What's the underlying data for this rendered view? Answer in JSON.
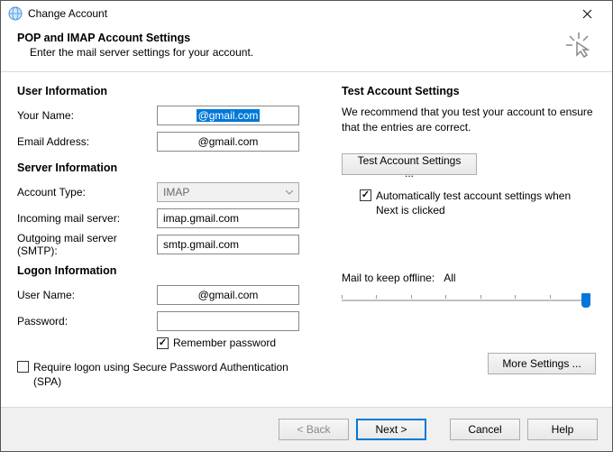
{
  "window": {
    "title": "Change Account"
  },
  "header": {
    "title": "POP and IMAP Account Settings",
    "subtitle": "Enter the mail server settings for your account."
  },
  "sections": {
    "user_info": "User Information",
    "server_info": "Server Information",
    "logon_info": "Logon Information",
    "test_settings": "Test Account Settings"
  },
  "labels": {
    "your_name": "Your Name:",
    "email_address": "Email Address:",
    "account_type": "Account Type:",
    "incoming": "Incoming mail server:",
    "outgoing": "Outgoing mail server (SMTP):",
    "user_name": "User Name:",
    "password": "Password:",
    "remember_password": "Remember password",
    "spa": "Require logon using Secure Password Authentication (SPA)",
    "recommend": "We recommend that you test your account to ensure that the entries are correct.",
    "auto_test": "Automatically test account settings when Next is clicked",
    "mail_offline_label": "Mail to keep offline:",
    "mail_offline_value": "All"
  },
  "values": {
    "your_name": "@gmail.com",
    "email_address": "@gmail.com",
    "account_type": "IMAP",
    "incoming": "imap.gmail.com",
    "outgoing": "smtp.gmail.com",
    "user_name": "@gmail.com",
    "password": ""
  },
  "checks": {
    "remember_password": true,
    "spa": false,
    "auto_test": true
  },
  "buttons": {
    "test": "Test Account Settings ...",
    "more": "More Settings ...",
    "back": "< Back",
    "next": "Next >",
    "cancel": "Cancel",
    "help": "Help"
  }
}
